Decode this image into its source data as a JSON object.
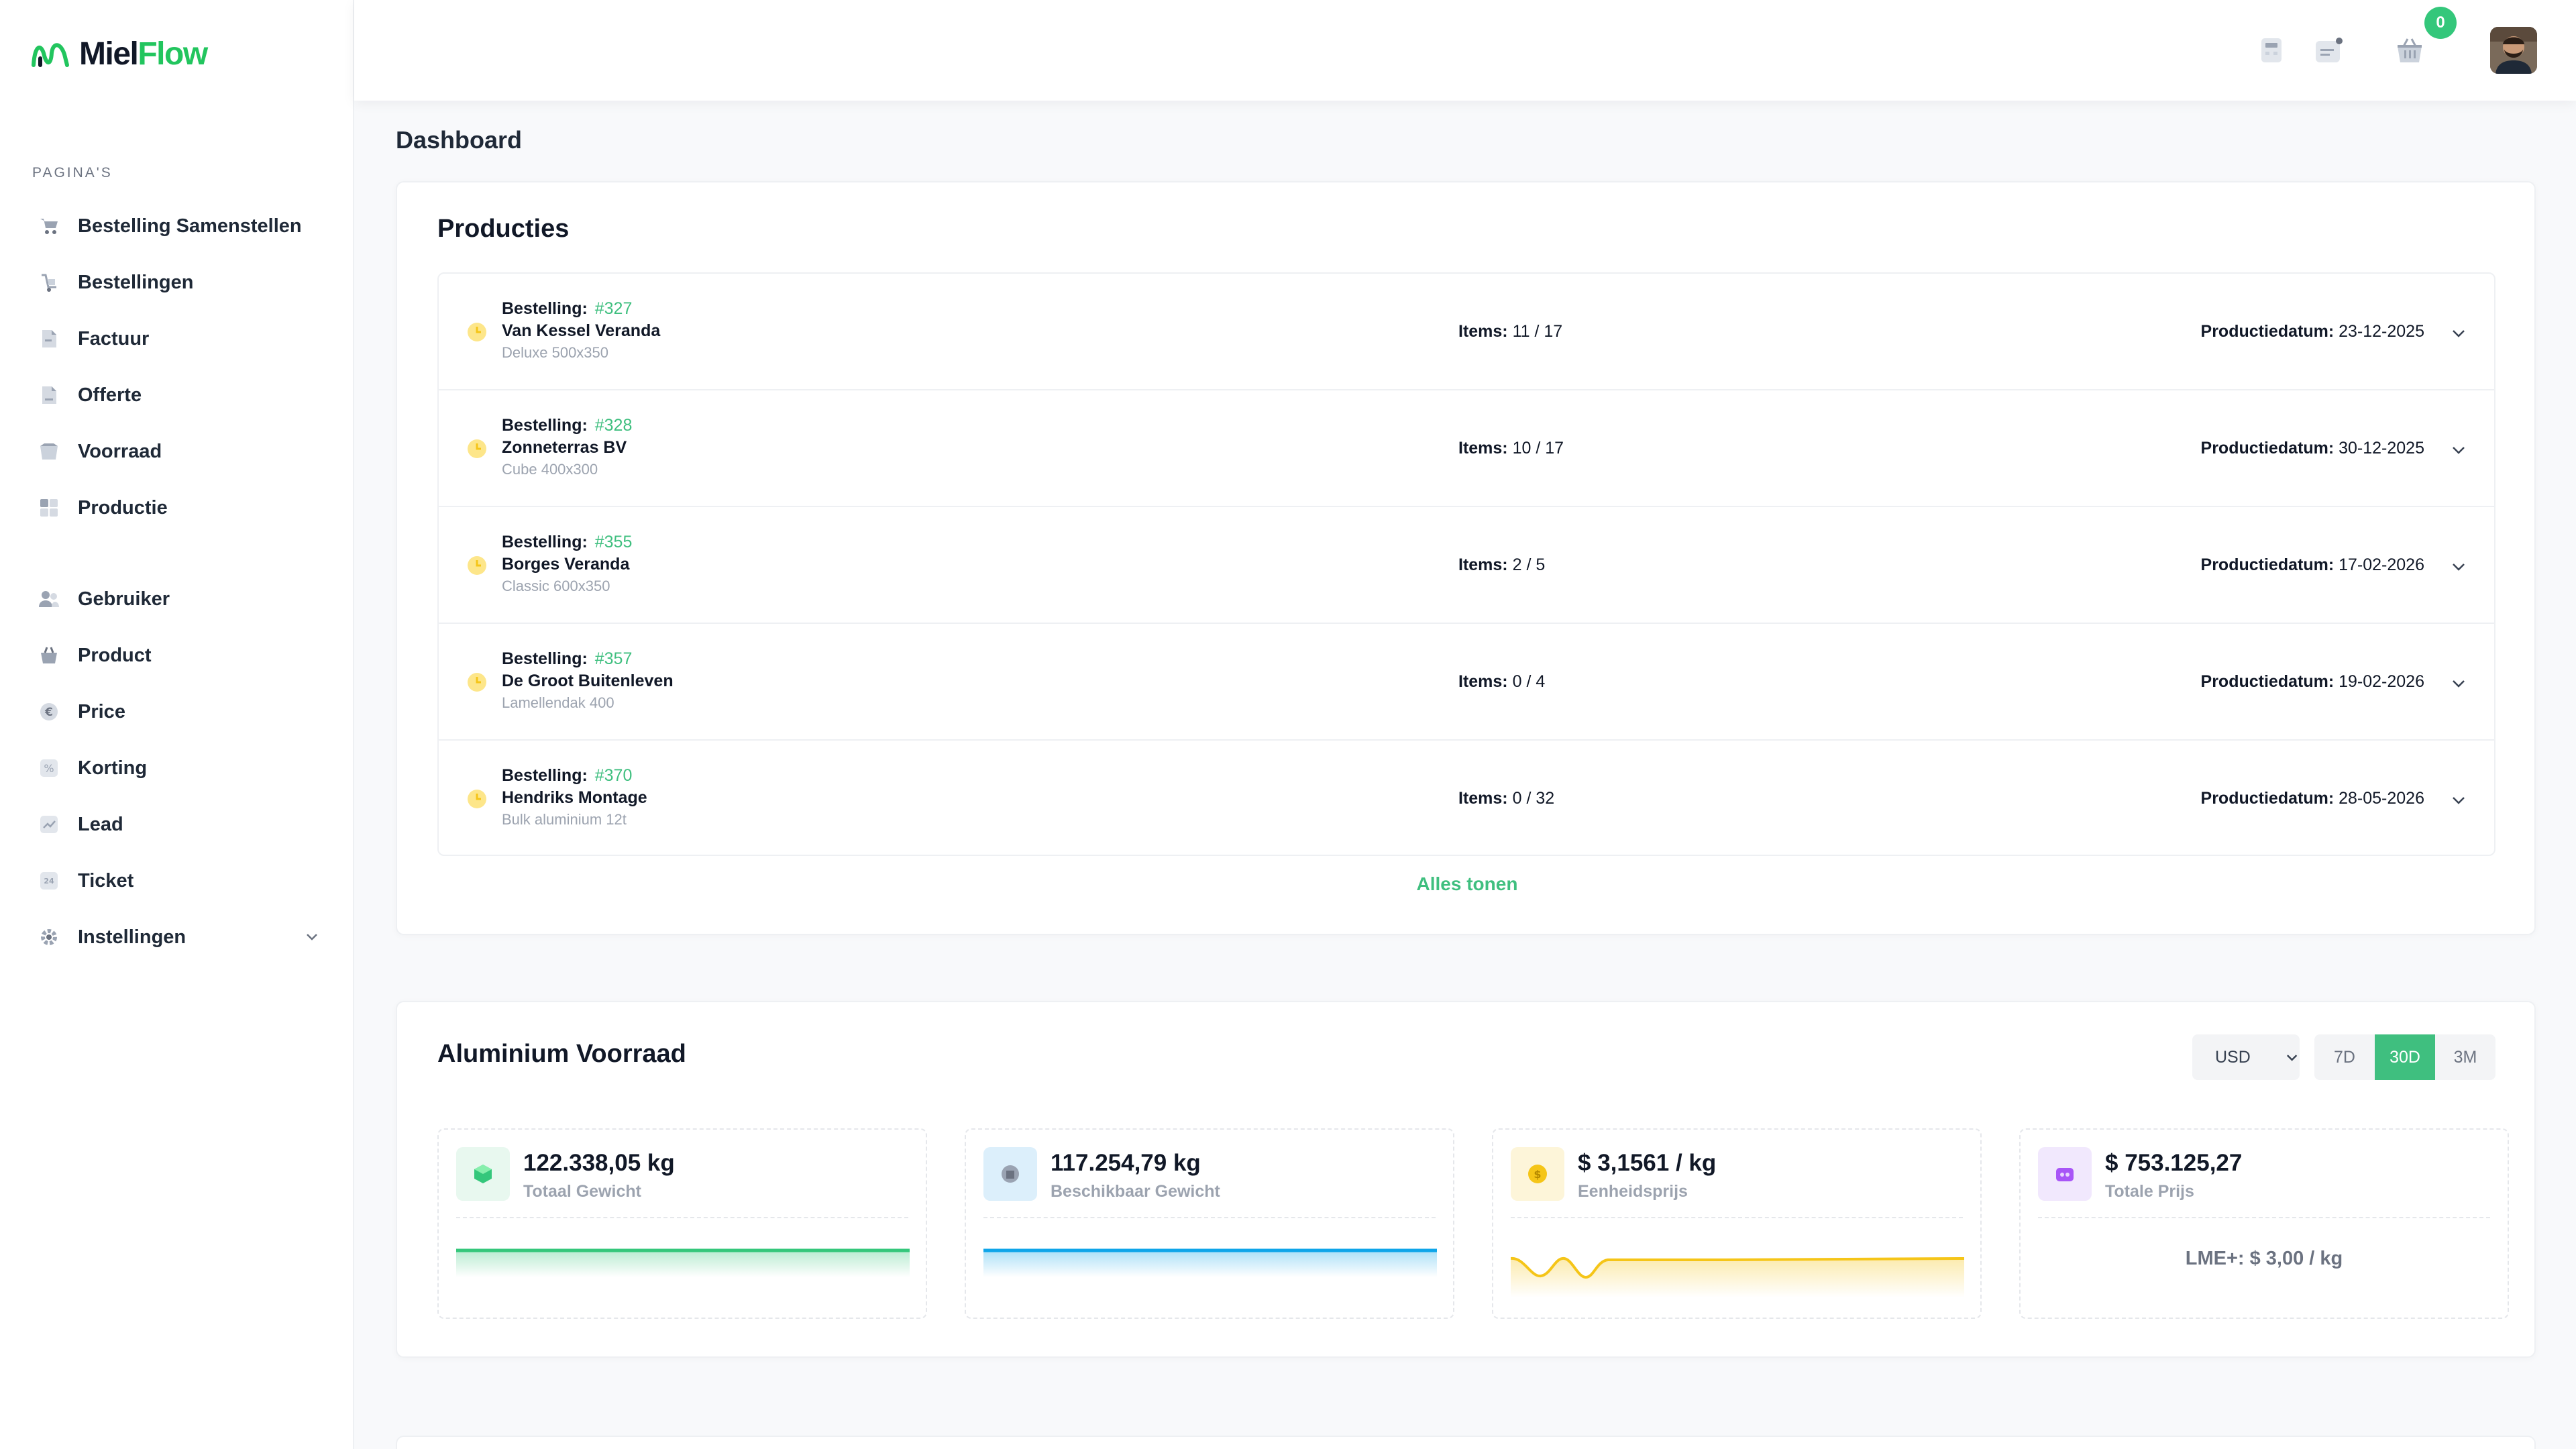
{
  "app": {
    "logo_text_main": "Miel",
    "logo_text_accent": "Flow",
    "brand_color": "#22c55e",
    "accent_color": "#3fbf7f"
  },
  "sidebar": {
    "section_label": "PAGINA'S",
    "items": [
      {
        "label": "Bestelling Samenstellen",
        "icon": "cart-icon"
      },
      {
        "label": "Bestellingen",
        "icon": "orders-icon"
      },
      {
        "label": "Factuur",
        "icon": "invoice-icon"
      },
      {
        "label": "Offerte",
        "icon": "quote-icon"
      },
      {
        "label": "Voorraad",
        "icon": "box-icon"
      },
      {
        "label": "Productie",
        "icon": "grid-icon"
      },
      {
        "label": "Gebruiker",
        "icon": "users-icon"
      },
      {
        "label": "Product",
        "icon": "basket-icon"
      },
      {
        "label": "Price",
        "icon": "euro-icon"
      },
      {
        "label": "Korting",
        "icon": "percent-icon"
      },
      {
        "label": "Lead",
        "icon": "chart-icon"
      },
      {
        "label": "Ticket",
        "icon": "ticket-icon"
      },
      {
        "label": "Instellingen",
        "icon": "gear-icon"
      }
    ]
  },
  "topbar": {
    "cart_count": "0"
  },
  "page": {
    "title": "Dashboard"
  },
  "productions": {
    "title": "Producties",
    "order_label": "Bestelling:",
    "items_label": "Items:",
    "date_label": "Productiedatum:",
    "rows": [
      {
        "number": "#327",
        "client": "Van Kessel Veranda",
        "model": "Deluxe 500x350",
        "items": "11 / 17",
        "date": "23-12-2025"
      },
      {
        "number": "#328",
        "client": "Zonneterras BV",
        "model": "Cube 400x300",
        "items": "10 / 17",
        "date": "30-12-2025"
      },
      {
        "number": "#355",
        "client": "Borges Veranda",
        "model": "Classic 600x350",
        "items": "2 / 5",
        "date": "17-02-2026"
      },
      {
        "number": "#357",
        "client": "De Groot Buitenleven",
        "model": "Lamellendak 400",
        "items": "0 / 4",
        "date": "19-02-2026"
      },
      {
        "number": "#370",
        "client": "Hendriks Montage",
        "model": "Bulk aluminium 12t",
        "items": "0 / 32",
        "date": "28-05-2026"
      }
    ],
    "show_all": "Alles tonen"
  },
  "aluminium": {
    "title": "Aluminium Voorraad",
    "currency": "USD",
    "ranges": [
      "7D",
      "30D",
      "3M"
    ],
    "active_range": "30D",
    "stats": [
      {
        "value": "122.338,05 kg",
        "label": "Totaal Gewicht",
        "icon": "cube-icon",
        "color": "#22c55e",
        "bg": "#e8f8ef"
      },
      {
        "value": "117.254,79 kg",
        "label": "Beschikbaar Gewicht",
        "icon": "package-icon",
        "color": "#0ea5e9",
        "bg": "#dceffb"
      },
      {
        "value": "$ 3,1561 / kg",
        "label": "Eenheidsprijs",
        "icon": "coin-icon",
        "color": "#f5c518",
        "bg": "#fdf5d9"
      },
      {
        "value": "$ 753.125,27",
        "label": "Totale Prijs",
        "icon": "wallet-icon",
        "color": "#a855f7",
        "bg": "#f1e8fd",
        "note": "LME+: $ 3,00 / kg"
      }
    ]
  }
}
